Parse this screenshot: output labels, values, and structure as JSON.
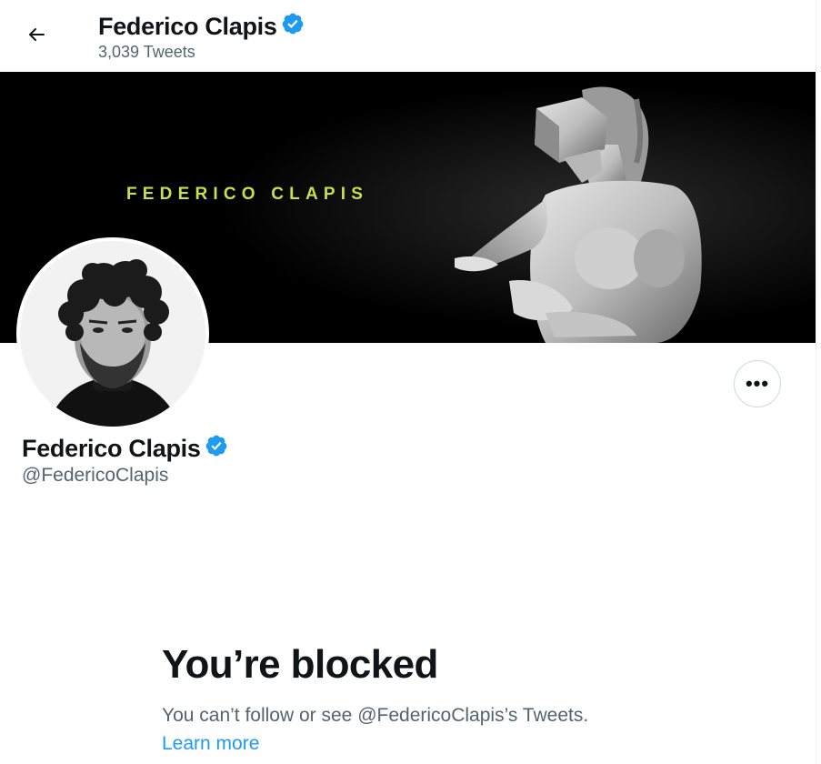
{
  "colors": {
    "accent": "#1d9bf0",
    "text_primary": "#0f1419",
    "text_secondary": "#536471",
    "banner_text": "#c9df4c",
    "banner_bg": "#000000"
  },
  "header": {
    "back_icon": "arrow-left-icon",
    "title": "Federico Clapis",
    "verified_icon": "verified-badge-icon",
    "tweet_count": "3,039 Tweets"
  },
  "banner": {
    "text": "FEDERICO CLAPIS",
    "image": "statue-with-vr-headset"
  },
  "profile": {
    "avatar": "profile-photo",
    "more_icon": "more-options-icon",
    "more_label": "•••",
    "name": "Federico Clapis",
    "verified_icon": "verified-badge-icon",
    "handle": "@FedericoClapis"
  },
  "blocked": {
    "title": "You’re blocked",
    "message": "You can’t follow or see @FedericoClapis’s Tweets.",
    "link": "Learn more"
  }
}
